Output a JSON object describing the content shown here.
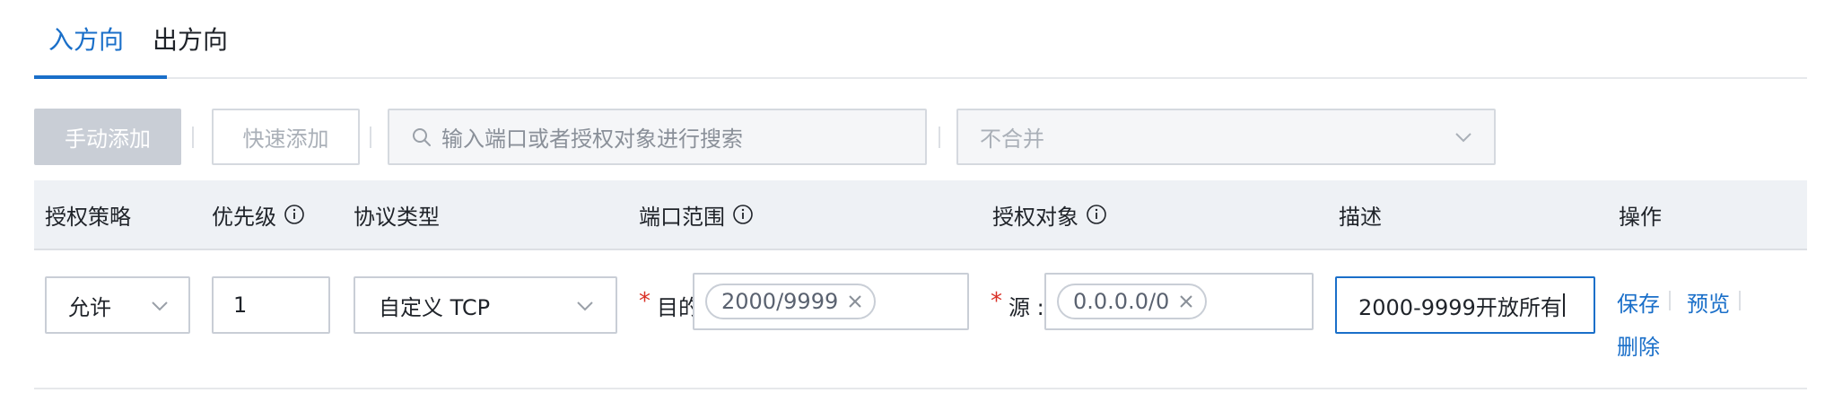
{
  "tabs": [
    {
      "label": "入方向",
      "active": true
    },
    {
      "label": "出方向",
      "active": false
    }
  ],
  "toolbar": {
    "manual_add": "手动添加",
    "quick_add": "快速添加",
    "search_placeholder": "输入端口或者授权对象进行搜索",
    "merge_value": "不合并"
  },
  "table": {
    "headers": [
      "授权策略",
      "优先级",
      "协议类型",
      "端口范围",
      "授权对象",
      "描述",
      "操作"
    ],
    "rows": [
      {
        "policy": "允许",
        "priority": "1",
        "protocol": "自定义 TCP",
        "port_label": "目的",
        "port_tag": "2000/9999",
        "source_label": "源 :",
        "source_tag": "0.0.0.0/0",
        "description": "2000-9999开放所有",
        "actions": {
          "save": "保存",
          "preview": "预览",
          "delete": "删除"
        }
      }
    ]
  },
  "required_mark": "*",
  "colors": {
    "accent": "#1a6fc9",
    "required": "#d93026",
    "header_bg": "#eef1f5",
    "disabled_button": "#c9ced6"
  }
}
